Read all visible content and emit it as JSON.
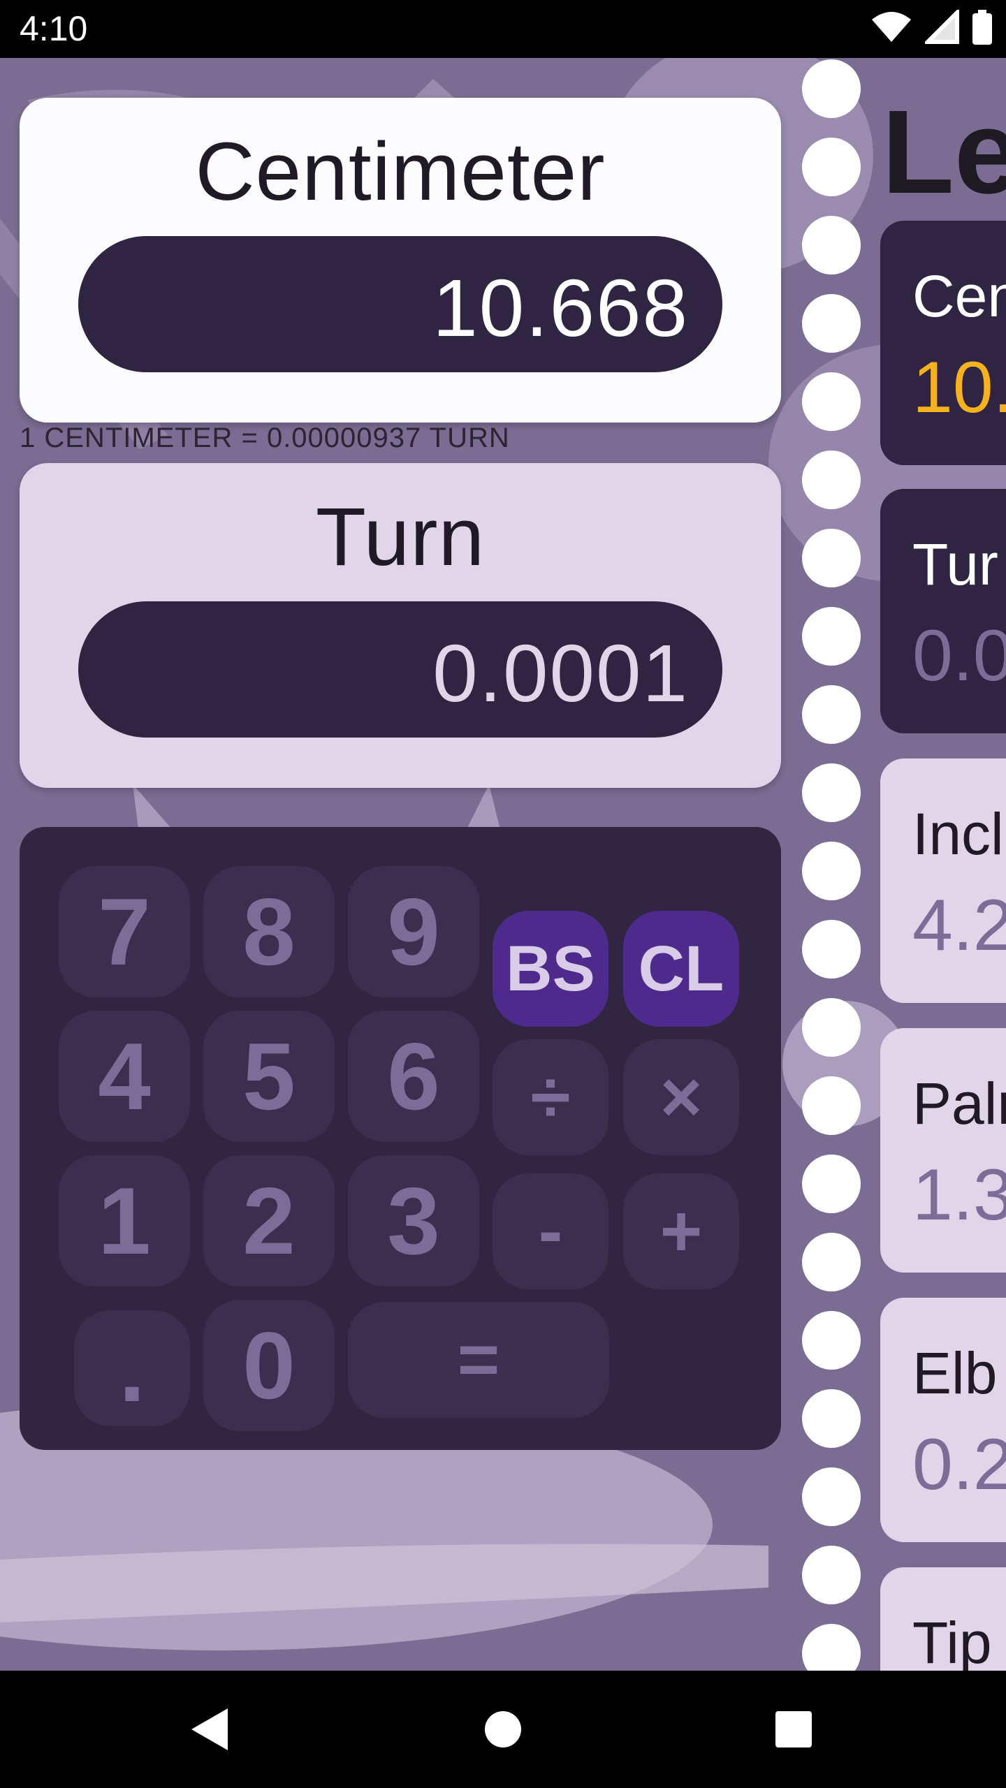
{
  "status": {
    "time": "4:10"
  },
  "converter": {
    "top": {
      "unit": "Centimeter",
      "value": "10.668"
    },
    "bottom": {
      "unit": "Turn",
      "value": "0.0001"
    },
    "ratio_text": "1 CENTIMETER = 0.00000937 TURN"
  },
  "keypad": {
    "k7": "7",
    "k8": "8",
    "k9": "9",
    "k4": "4",
    "k5": "5",
    "k6": "6",
    "k1": "1",
    "k2": "2",
    "k3": "3",
    "kdot": ".",
    "k0": "0",
    "backspace": "BS",
    "clear": "CL",
    "divide": "÷",
    "multiply": "×",
    "minus": "-",
    "plus": "+",
    "equals": "="
  },
  "side_panel": {
    "title": "Le",
    "items": [
      {
        "label": "Cen",
        "value": "10."
      },
      {
        "label": "Tur",
        "value": "0.0"
      },
      {
        "label": "Incl",
        "value": "4.2"
      },
      {
        "label": "Palr",
        "value": "1.3."
      },
      {
        "label": "Elb",
        "value": "0.2"
      },
      {
        "label": "Tip",
        "value": ""
      }
    ]
  },
  "colors": {
    "background": "#7a6c93",
    "pill": "#2f2442",
    "keypad": "#312641",
    "accent_key": "#4d2a8b",
    "highlight_value": "#f5b21e"
  }
}
